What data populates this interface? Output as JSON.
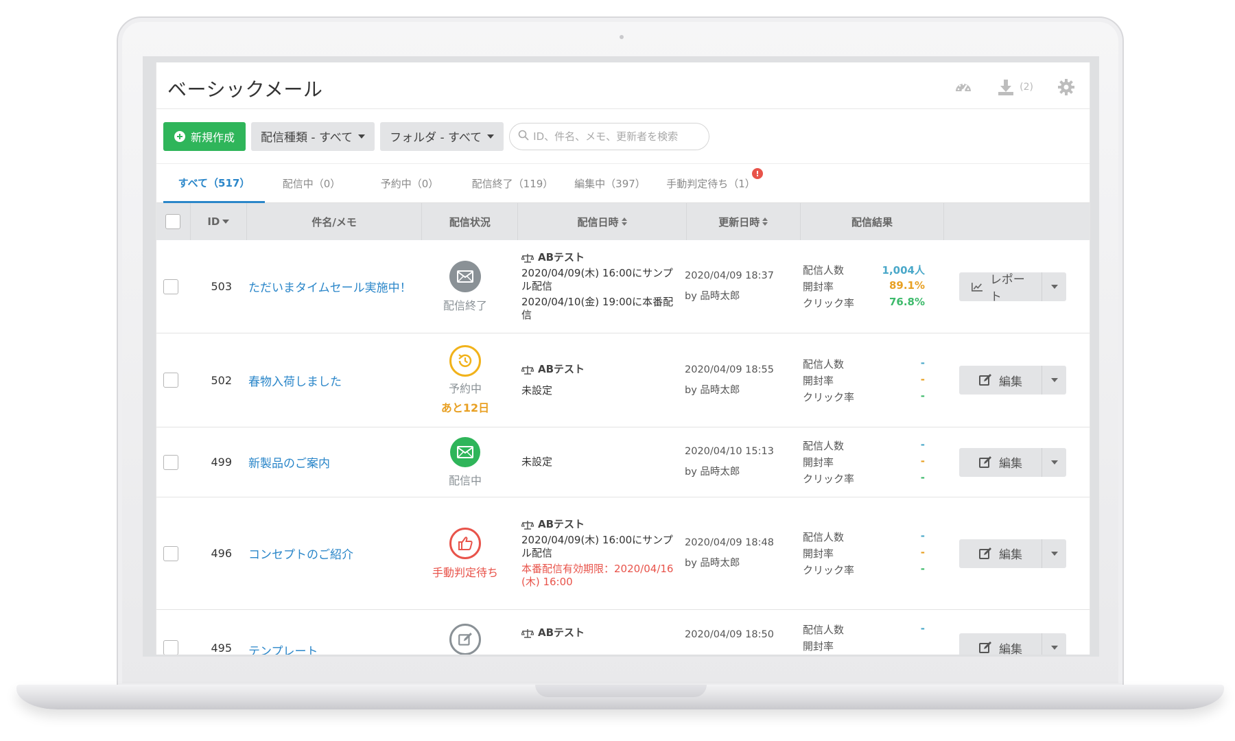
{
  "page": {
    "title": "ベーシックメール"
  },
  "header": {
    "download_count": "(2)"
  },
  "toolbar": {
    "new_label": "新規作成",
    "type_filter": "配信種類 - すべて",
    "folder_filter": "フォルダ - すべて",
    "search_placeholder": "ID、件名、メモ、更新者を検索"
  },
  "tabs": [
    {
      "label": "すべて（517）"
    },
    {
      "label": "配信中（0）"
    },
    {
      "label": "予約中（0）"
    },
    {
      "label": "配信終了（119）"
    },
    {
      "label": "編集中（397）"
    },
    {
      "label": "手動判定待ち（1）",
      "alert": "!"
    }
  ],
  "columns": {
    "id": "ID",
    "subject": "件名/メモ",
    "status": "配信状況",
    "date": "配信日時",
    "updated": "更新日時",
    "result": "配信結果"
  },
  "labels": {
    "recipients": "配信人数",
    "open_rate": "開封率",
    "click_rate": "クリック率",
    "report": "レポート",
    "edit": "編集",
    "ab_test": "ABテスト"
  },
  "rows": [
    {
      "id": "503",
      "subject": "ただいまタイムセール実施中！",
      "status": "配信終了",
      "date_line1": "2020/04/09(木) 16:00にサンプル配信",
      "date_line2": "2020/04/10(金) 19:00に本番配信",
      "updated": "2020/04/09 18:37",
      "updated_by": "by 品時太郎",
      "recipients": "1,004人",
      "open_rate": "89.1%",
      "click_rate": "76.8%"
    },
    {
      "id": "502",
      "subject": "春物入荷しました",
      "status": "予約中",
      "status_sub": "あと12日",
      "date_line1": "未設定",
      "updated": "2020/04/09 18:55",
      "updated_by": "by 品時太郎",
      "recipients": "-",
      "open_rate": "-",
      "click_rate": "-"
    },
    {
      "id": "499",
      "subject": "新製品のご案内",
      "status": "配信中",
      "date_line1": "未設定",
      "updated": "2020/04/10 15:13",
      "updated_by": "by 品時太郎",
      "recipients": "-",
      "open_rate": "-",
      "click_rate": "-"
    },
    {
      "id": "496",
      "subject": "コンセプトのご紹介",
      "status": "手動判定待ち",
      "date_line1": "2020/04/09(木) 16:00にサンプル配信",
      "date_line2": "本番配信有効期限：2020/04/16 (木) 16:00",
      "updated": "2020/04/09 18:48",
      "updated_by": "by 品時太郎",
      "recipients": "-",
      "open_rate": "-",
      "click_rate": "-"
    },
    {
      "id": "495",
      "subject": "テンプレート",
      "updated": "2020/04/09 18:50",
      "recipients": "-"
    }
  ],
  "colors": {
    "accent": "#2a86c9",
    "new_button": "#2fb55a",
    "status_done": "#8a9196",
    "status_scheduled": "#f1b21a",
    "status_sending": "#2fb55a",
    "status_manual": "#e8534a",
    "open_rate": "#e8a023",
    "click_rate": "#3dba6b"
  }
}
